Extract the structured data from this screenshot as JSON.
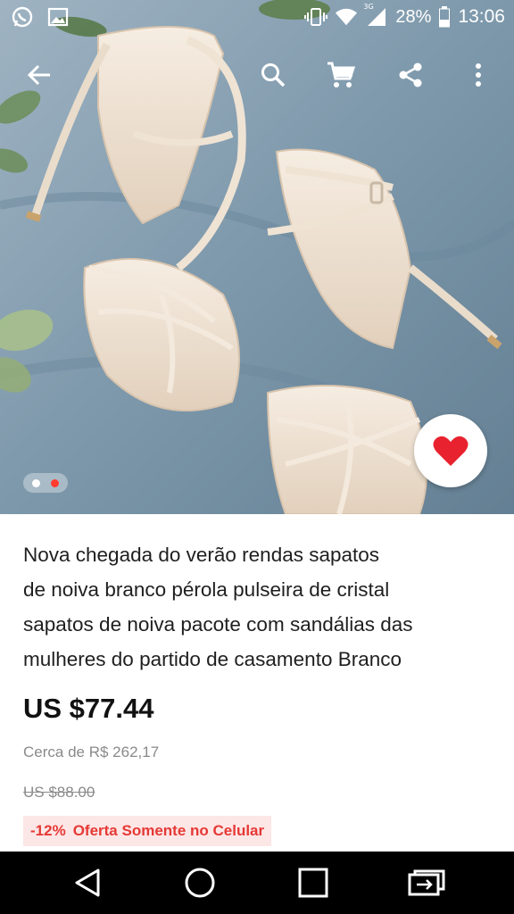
{
  "status_bar": {
    "battery_percent": "28%",
    "time": "13:06",
    "network": "3G",
    "icons": [
      "whatsapp-icon",
      "gallery-icon",
      "vibrate-icon",
      "wifi-icon",
      "signal-icon",
      "battery-icon"
    ]
  },
  "toolbar": {
    "icons": [
      "back-arrow-icon",
      "search-icon",
      "cart-icon",
      "share-icon",
      "more-vert-icon"
    ]
  },
  "gallery": {
    "page_count": 2,
    "active_index": 0
  },
  "product": {
    "title_lines": [
      "Nova chegada do verão rendas sapatos",
      "de noiva branco pérola pulseira de cristal",
      "sapatos de noiva pacote com sandálias das",
      "mulheres do partido de casamento Branco"
    ],
    "price": "US $77.44",
    "approx_local_price": "Cerca de R$ 262,17",
    "original_price": "US $88.00",
    "discount": "-12%",
    "promo_label": "Oferta Somente no Celular"
  },
  "colors": {
    "accent_red": "#e53935",
    "promo_bg": "#fde6e6",
    "heart": "#e8222f"
  },
  "nav_bar": {
    "icons": [
      "nav-back-icon",
      "nav-home-icon",
      "nav-recents-icon",
      "screen-switch-icon"
    ]
  }
}
